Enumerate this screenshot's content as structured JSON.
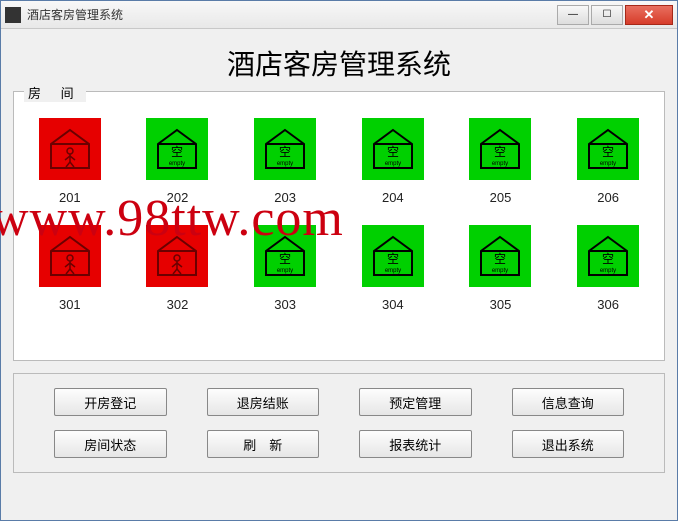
{
  "window": {
    "title": "酒店客房管理系统"
  },
  "header": {
    "title": "酒店客房管理系统"
  },
  "rooms_panel": {
    "label": "房 间"
  },
  "rooms": [
    {
      "number": "201",
      "status": "occupied"
    },
    {
      "number": "202",
      "status": "empty"
    },
    {
      "number": "203",
      "status": "empty"
    },
    {
      "number": "204",
      "status": "empty"
    },
    {
      "number": "205",
      "status": "empty"
    },
    {
      "number": "206",
      "status": "empty"
    },
    {
      "number": "301",
      "status": "occupied"
    },
    {
      "number": "302",
      "status": "occupied"
    },
    {
      "number": "303",
      "status": "empty"
    },
    {
      "number": "304",
      "status": "empty"
    },
    {
      "number": "305",
      "status": "empty"
    },
    {
      "number": "306",
      "status": "empty"
    }
  ],
  "room_status_labels": {
    "empty_cn": "空",
    "empty_en": "empty"
  },
  "buttons": {
    "checkin": "开房登记",
    "checkout": "退房结账",
    "reservation": "预定管理",
    "query": "信息查询",
    "room_status": "房间状态",
    "refresh": "刷　新",
    "report": "报表统计",
    "exit": "退出系统"
  },
  "watermark": "www.98ttw.com"
}
